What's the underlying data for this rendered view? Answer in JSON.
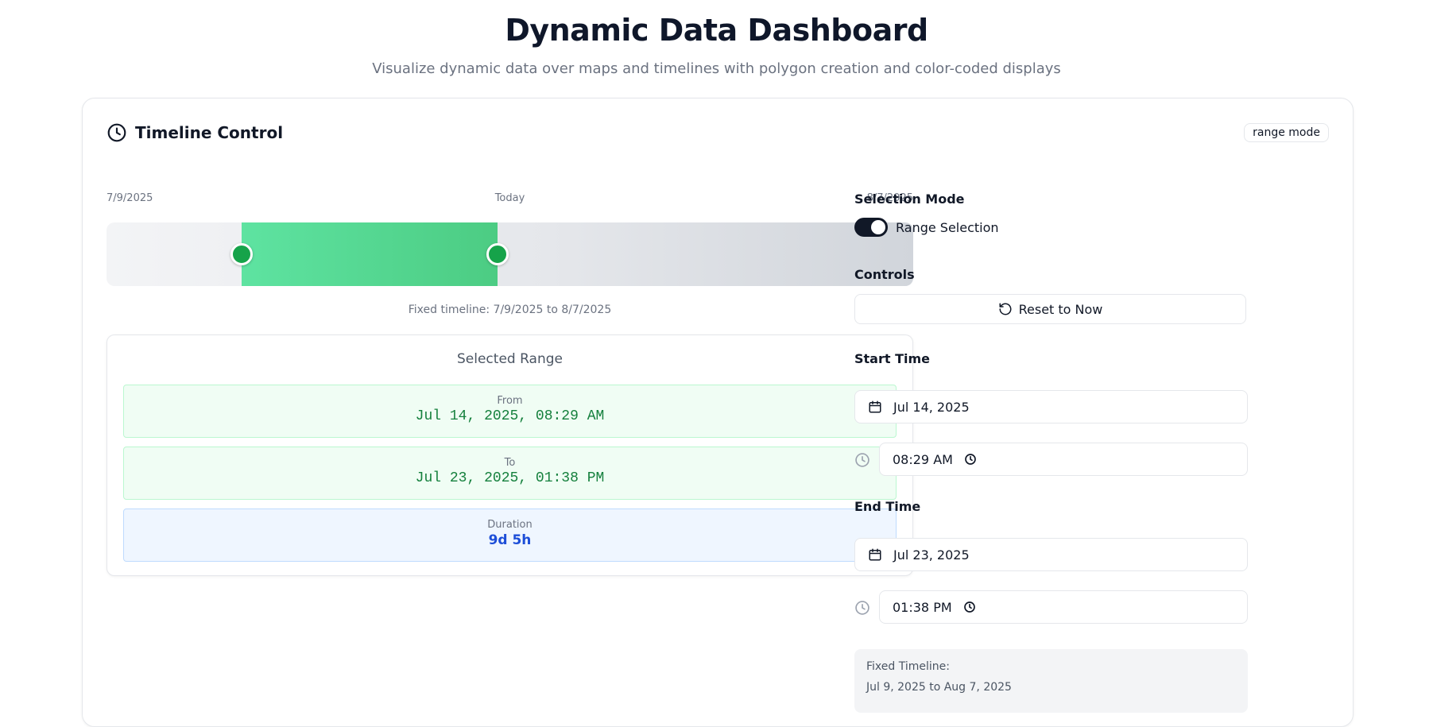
{
  "page": {
    "title": "Dynamic Data Dashboard",
    "subtitle": "Visualize dynamic data over maps and timelines with polygon creation and color-coded displays"
  },
  "card": {
    "title": "Timeline Control",
    "mode_badge": "range mode",
    "icon": "clock-icon"
  },
  "timeline": {
    "start_label": "7/9/2025",
    "mid_label": "Today",
    "end_label": "8/7/2025",
    "range_start_fraction": 0.167,
    "range_end_fraction": 0.485,
    "caption": "Fixed timeline: 7/9/2025 to 8/7/2025",
    "range_color": "#4ccc83",
    "handle_color": "#16a34a"
  },
  "selected_range": {
    "title": "Selected Range",
    "from_label": "From",
    "from_value": "Jul 14, 2025, 08:29 AM",
    "to_label": "To",
    "to_value": "Jul 23, 2025, 01:38 PM",
    "duration_label": "Duration",
    "duration_value": "9d 5h"
  },
  "controls_panel": {
    "selection_mode_label": "Selection Mode",
    "toggle_label": "Range Selection",
    "toggle_on": true,
    "controls_label": "Controls",
    "reset_button": "Reset to Now",
    "start_time_label": "Start Time",
    "start_date": "Jul 14, 2025",
    "start_time": "08:29 AM",
    "end_time_label": "End Time",
    "end_date": "Jul 23, 2025",
    "end_time": "01:38 PM",
    "fixed_timeline_label": "Fixed Timeline:",
    "fixed_timeline_value": "Jul 9, 2025 to Aug 7, 2025"
  }
}
